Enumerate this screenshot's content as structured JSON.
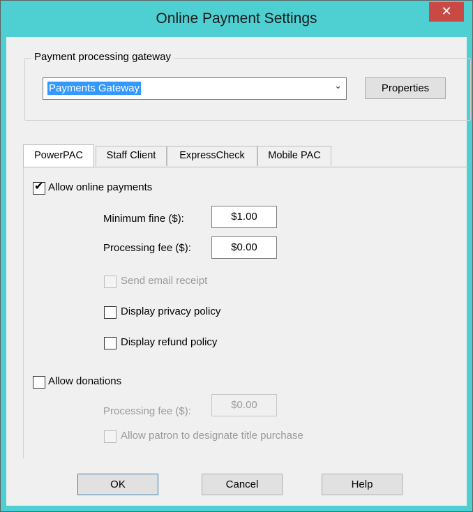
{
  "window": {
    "title": "Online Payment Settings",
    "close_glyph": "✕"
  },
  "gateway": {
    "group_label": "Payment processing gateway",
    "selected": "Payments Gateway",
    "arrow_glyph": "⌄",
    "properties_label": "Properties"
  },
  "tabs": [
    "PowerPAC",
    "Staff Client",
    "ExpressCheck",
    "Mobile PAC"
  ],
  "active_tab": "PowerPAC",
  "payments": {
    "allow_label": "Allow online payments",
    "allow_checked": true,
    "min_fine_label": "Minimum fine ($):",
    "min_fine_value": "$1.00",
    "proc_fee_label": "Processing fee ($):",
    "proc_fee_value": "$0.00",
    "email_receipt_label": "Send email receipt",
    "email_receipt_checked": false,
    "privacy_label": "Display privacy policy",
    "privacy_checked": false,
    "refund_label": "Display refund policy",
    "refund_checked": false
  },
  "donations": {
    "allow_label": "Allow donations",
    "allow_checked": false,
    "proc_fee_label": "Processing fee ($):",
    "proc_fee_value": "$0.00",
    "designate_label": "Allow patron to designate title purchase",
    "designate_checked": false
  },
  "buttons": {
    "ok": "OK",
    "cancel": "Cancel",
    "help": "Help"
  },
  "check_glyph": "✔"
}
